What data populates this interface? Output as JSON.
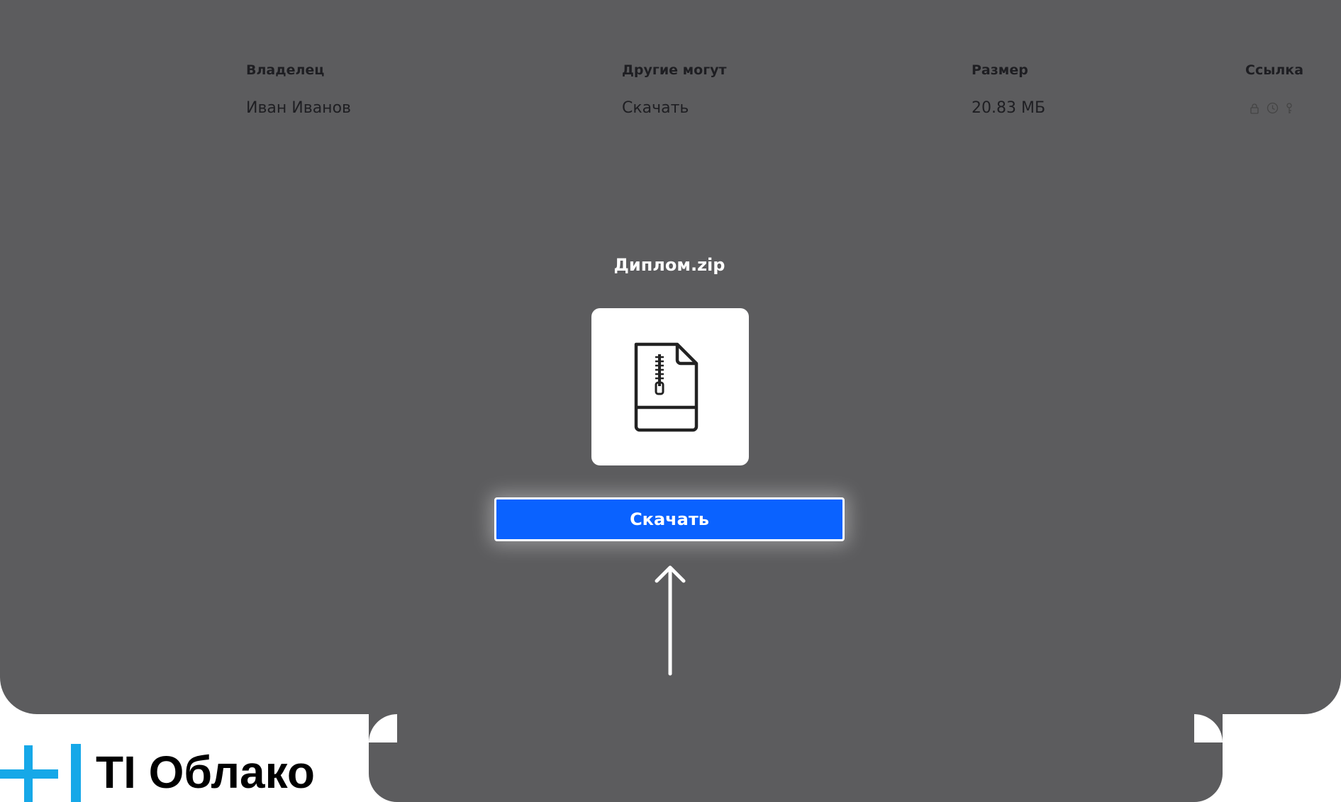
{
  "table": {
    "headers": {
      "owner": "Владелец",
      "permissions": "Другие могут",
      "size": "Размер",
      "link": "Ссылка"
    },
    "row": {
      "owner": "Иван Иванов",
      "permissions": "Скачать",
      "size": "20.83 МБ"
    }
  },
  "file": {
    "name": "Диплом.zip",
    "icon": "zip-file-icon"
  },
  "actions": {
    "download_label": "Скачать"
  },
  "link_icons": [
    "lock-icon",
    "clock-icon",
    "key-icon"
  ],
  "brand": {
    "name": "TI Облако",
    "accent_color": "#16a8e8"
  },
  "colors": {
    "backdrop": "#5c5c5e",
    "button": "#0a62ff"
  }
}
